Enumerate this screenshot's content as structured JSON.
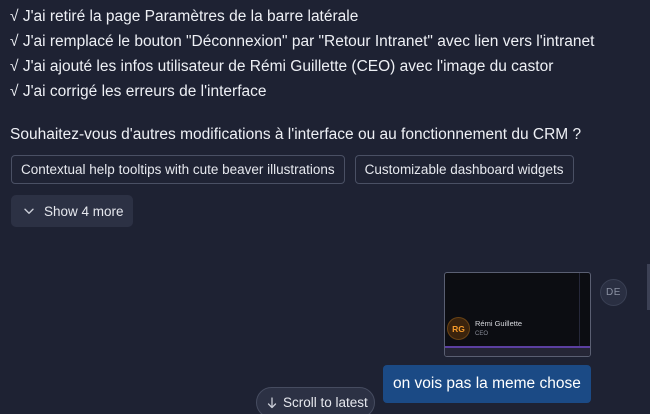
{
  "assistant_message": {
    "changes": [
      "√ J'ai retiré la page Paramètres de la barre latérale",
      "√ J'ai remplacé le bouton \"Déconnexion\" par \"Retour Intranet\" avec lien vers l'intranet",
      "√ J'ai ajouté les infos utilisateur de Rémi Guillette (CEO) avec l'image du castor",
      "√ J'ai corrigé les erreurs de l'interface"
    ],
    "question": "Souhaitez-vous d'autres modifications à l'interface ou au fonctionnement du CRM ?"
  },
  "suggestions": [
    "Contextual help tooltips with cute beaver illustrations",
    "Customizable dashboard widgets"
  ],
  "show_more_label": "Show 4 more",
  "user_avatar_initials": "DE",
  "attachment": {
    "avatar_initials": "RG",
    "name": "Rémi Guillette",
    "role": "CEO"
  },
  "user_message": "on vois pas la meme chose",
  "scroll_to_latest_label": "Scroll to latest",
  "icons": {
    "show_more": "chevron-down-icon",
    "scroll_latest": "arrow-down-icon"
  },
  "colors": {
    "background": "#1e2233",
    "user_bubble": "#1b4a85",
    "avatar_accent": "#f59a2a",
    "attachment_bar": "#5b3fa0"
  }
}
